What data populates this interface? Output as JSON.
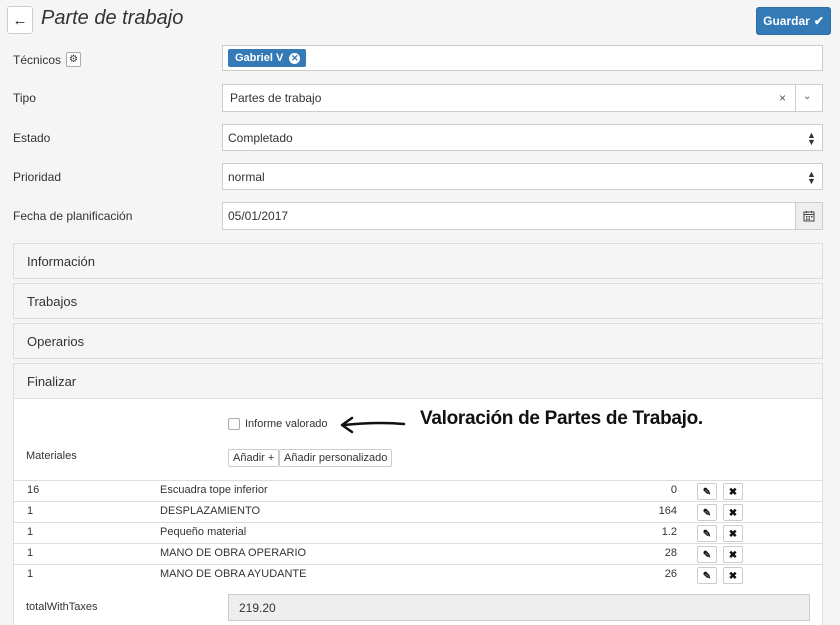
{
  "header": {
    "title": "Parte de trabajo",
    "save_label": "Guardar"
  },
  "form": {
    "tecnicos_label": "Técnicos",
    "tecnicos_tag": "Gabriel V",
    "tipo_label": "Tipo",
    "tipo_value": "Partes de trabajo",
    "estado_label": "Estado",
    "estado_value": "Completado",
    "prioridad_label": "Prioridad",
    "prioridad_value": "normal",
    "fecha_label": "Fecha de planificación",
    "fecha_value": "05/01/2017"
  },
  "panels": {
    "informacion": "Información",
    "trabajos": "Trabajos",
    "operarios": "Operarios",
    "finalizar": "Finalizar"
  },
  "finalizar": {
    "informe_label": "Informe valorado",
    "materiales_label": "Materiales",
    "add_label": "Añadir +",
    "add_custom_label": "Añadir personalizado",
    "annotation": "Valoración de Partes de Trabajo.",
    "total_label": "totalWithTaxes",
    "total_value": "219.20"
  },
  "materials": [
    {
      "qty": "16",
      "name": "Escuadra tope inferior",
      "value": "0"
    },
    {
      "qty": "1",
      "name": "DESPLAZAMIENTO",
      "value": "164"
    },
    {
      "qty": "1",
      "name": "Pequeño material",
      "value": "1.2"
    },
    {
      "qty": "1",
      "name": "MANO DE OBRA OPERARIO",
      "value": "28"
    },
    {
      "qty": "1",
      "name": "MANO DE OBRA AYUDANTE",
      "value": "26"
    }
  ],
  "icons": {
    "back": "arrow-left-icon",
    "save": "check-icon",
    "settings": "gear-icon",
    "remove_tag": "close-circle-icon",
    "clear": "close-icon",
    "dropdown": "chevron-down-icon",
    "select": "sort-icon",
    "calendar": "calendar-icon",
    "edit": "pencil-icon",
    "delete": "close-icon",
    "annotation_arrow": "arrow-left-icon"
  },
  "colors": {
    "primary": "#337ab7"
  }
}
